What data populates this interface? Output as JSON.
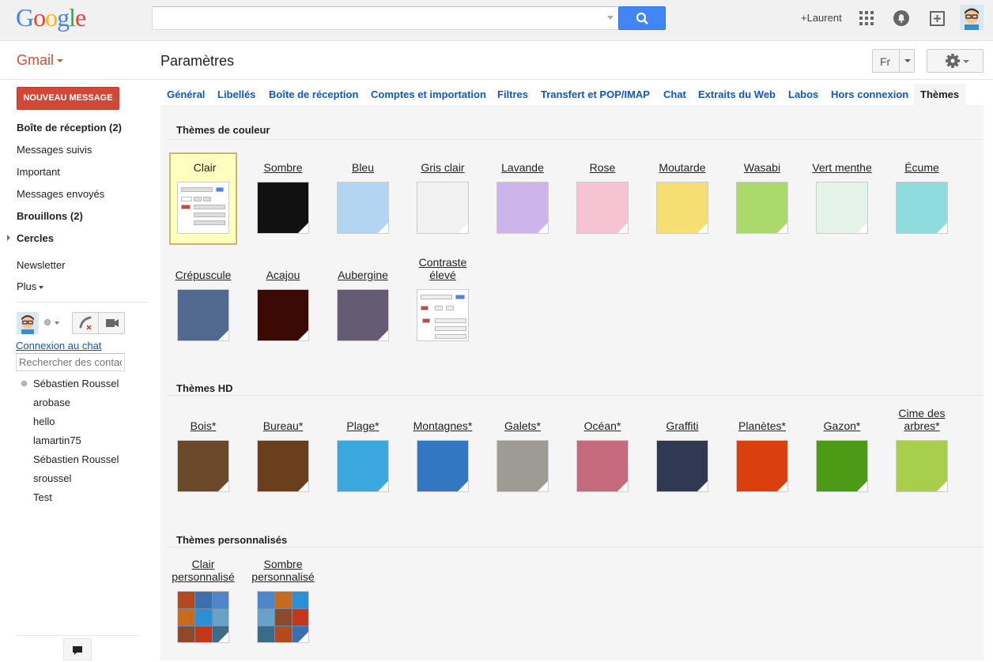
{
  "header": {
    "logo_letters": [
      "G",
      "o",
      "o",
      "g",
      "l",
      "e"
    ],
    "search_placeholder": "",
    "user_name": "+Laurent",
    "icons": [
      "apps-grid-icon",
      "notifications-bell-icon",
      "share-plus-icon",
      "account-avatar-icon"
    ]
  },
  "subheader": {
    "gmail_label": "Gmail",
    "page_title": "Paramètres",
    "lang": "Fr"
  },
  "nav": {
    "compose": "NOUVEAU MESSAGE",
    "items": [
      {
        "label": "Boîte de réception (2)",
        "bold": true
      },
      {
        "label": "Messages suivis",
        "bold": false
      },
      {
        "label": "Important",
        "bold": false
      },
      {
        "label": "Messages envoyés",
        "bold": false
      },
      {
        "label": "Brouillons (2)",
        "bold": true
      },
      {
        "label": "Cercles",
        "bold": true
      },
      {
        "label": "Newsletter",
        "bold": false
      },
      {
        "label": "Plus",
        "bold": false
      }
    ],
    "chat_connect": "Connexion au chat",
    "contact_search_placeholder": "Rechercher des contacts",
    "contacts": [
      "Sébastien Roussel",
      "arobase",
      "hello",
      "lamartin75",
      "Sébastien Roussel",
      "sroussel",
      "Test"
    ]
  },
  "tabs": [
    "Général",
    "Libellés",
    "Boîte de réception",
    "Comptes et importation",
    "Filtres",
    "Transfert et POP/IMAP",
    "Chat",
    "Extraits du Web",
    "Labos",
    "Hors connexion",
    "Thèmes"
  ],
  "active_tab": "Thèmes",
  "sections": {
    "color": "Thèmes de couleur",
    "hd": "Thèmes HD",
    "custom": "Thèmes personnalisés"
  },
  "color_themes": [
    {
      "name": "Clair",
      "color": "#ffffff",
      "selected": true
    },
    {
      "name": "Sombre",
      "color": "#111111"
    },
    {
      "name": "Bleu",
      "color": "#b4d5f2"
    },
    {
      "name": "Gris clair",
      "color": "#f2f2f2"
    },
    {
      "name": "Lavande",
      "color": "#cdb5ec"
    },
    {
      "name": "Rose",
      "color": "#f6c3d2"
    },
    {
      "name": "Moutarde",
      "color": "#f6df72"
    },
    {
      "name": "Wasabi",
      "color": "#acd96c"
    },
    {
      "name": "Vert menthe",
      "color": "#e3f3ea"
    },
    {
      "name": "Écume",
      "color": "#8fdcdf"
    },
    {
      "name": "Crépuscule",
      "color": "#51698f"
    },
    {
      "name": "Acajou",
      "color": "#3c0a05"
    },
    {
      "name": "Aubergine",
      "color": "#655c73"
    },
    {
      "name": "Contraste élevé",
      "color": "#ffffff"
    }
  ],
  "hd_themes": [
    {
      "name": "Bois*",
      "color": "#6b4a2c"
    },
    {
      "name": "Bureau*",
      "color": "#6a3f1e"
    },
    {
      "name": "Plage*",
      "color": "#3aa7de"
    },
    {
      "name": "Montagnes*",
      "color": "#3377c2"
    },
    {
      "name": "Galets*",
      "color": "#9e9a94"
    },
    {
      "name": "Océan*",
      "color": "#c66a7e"
    },
    {
      "name": "Graffiti",
      "color": "#2f3a52"
    },
    {
      "name": "Planètes*",
      "color": "#d9400d"
    },
    {
      "name": "Gazon*",
      "color": "#4c9a16"
    },
    {
      "name": "Cime des arbres*",
      "color": "#a8cf4c"
    }
  ],
  "custom_themes": [
    {
      "name": "Clair personnalisé",
      "color": "#6a8fb2"
    },
    {
      "name": "Sombre personnalisé",
      "color": "#6a8fb2"
    }
  ]
}
